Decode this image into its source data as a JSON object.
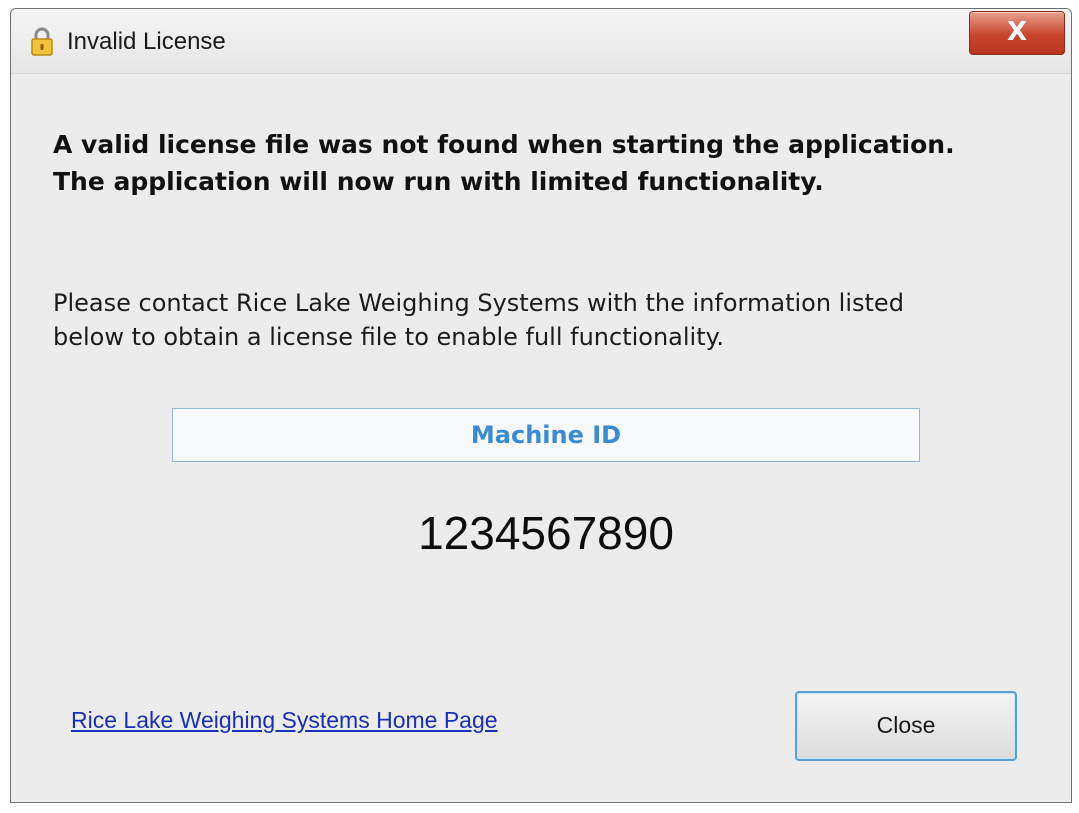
{
  "window": {
    "title": "Invalid License",
    "close_glyph": "X",
    "icon": "lock-icon"
  },
  "message": {
    "line1": "A valid license file was not found when starting the application.",
    "line2": "The application will now run with limited functionality."
  },
  "info": {
    "line1": "Please contact Rice Lake Weighing Systems with the information listed",
    "line2": "below to obtain a license file to enable full functionality."
  },
  "machine": {
    "label": "Machine ID",
    "value": "1234567890"
  },
  "footer": {
    "link_label": "Rice Lake Weighing Systems Home Page",
    "close_label": "Close"
  },
  "colors": {
    "link": "#1a2fb8",
    "machine_label": "#3a8ad6",
    "close_x_bg": "#c8452c"
  }
}
